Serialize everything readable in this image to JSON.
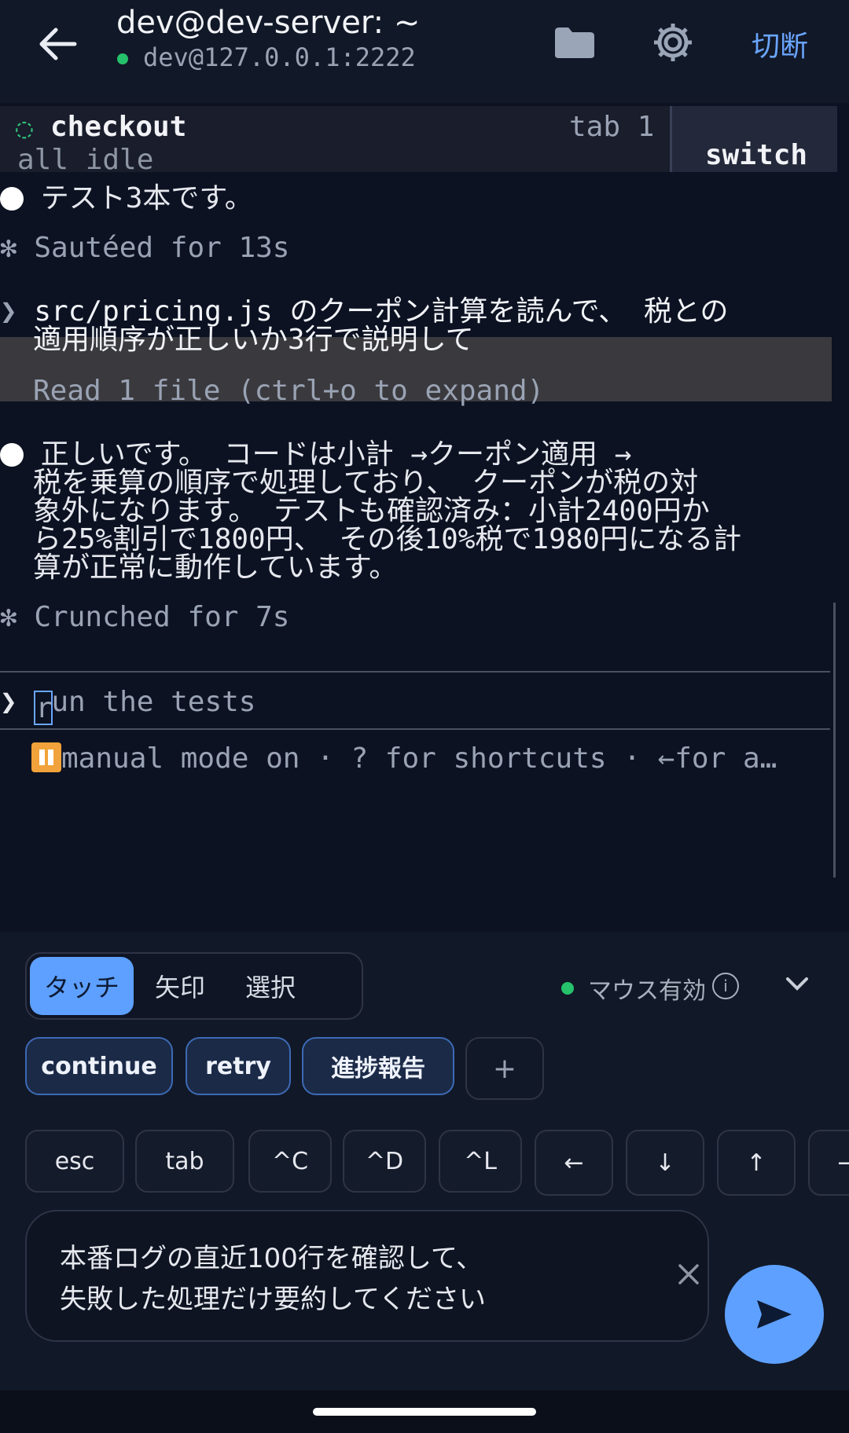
{
  "header": {
    "title": "dev@dev-server: ~",
    "subtitle": "dev@127.0.0.1:2222",
    "disconnect_label": "切断",
    "status_color": "#25c26b",
    "accent": "#6aa5ff"
  },
  "terminal": {
    "tab": {
      "spinner": "◌",
      "name": "checkout",
      "index": "tab 1",
      "status": "all idle",
      "switch_label": "switch"
    },
    "lines": {
      "msg1": "テスト3本です。",
      "sauteed": "Sautéed for 13s",
      "user_prompt_1": "src/pricing.js のクーポン計算を読んで、 税との",
      "user_prompt_2": "適用順序が正しいか3行で説明して",
      "read_file": "Read 1 file (ctrl+o to expand)",
      "answer_1": "正しいです。 コードは小計 →クーポン適用 →",
      "answer_2": "税を乗算の順序で処理しており、 クーポンが税の対",
      "answer_3": "象外になります。 テストも確認済み：小計2400円か",
      "answer_4": "ら25%割引で1800円、 その後10%税で1980円になる計",
      "answer_5": "算が正常に動作しています。",
      "crunched": "Crunched for 7s",
      "input_placeholder_rest": "un the tests",
      "input_placeholder_first": "r",
      "mode_line": "manual mode on · ? for shortcuts · ←for a…"
    },
    "star_glyph": "✻",
    "prompt_glyph": "❯"
  },
  "controls": {
    "modes": [
      "タッチ",
      "矢印",
      "選択"
    ],
    "active_mode": "タッチ",
    "mouse_label": "マウス有効",
    "info_glyph": "i",
    "chips": [
      "continue",
      "retry",
      "進捗報告"
    ],
    "add_chip": "+",
    "keys": [
      "esc",
      "tab",
      "^C",
      "^D",
      "^L",
      "←",
      "↓",
      "↑",
      "→"
    ],
    "input_value": "本番ログの直近100行を確認して、\n失敗した処理だけ要約してください"
  },
  "icons": {
    "back": "arrow-left-icon",
    "folder": "folder-icon",
    "settings": "gear-icon",
    "info": "info-icon",
    "collapse": "chevron-down-icon",
    "clear": "close-icon",
    "send": "send-icon"
  }
}
